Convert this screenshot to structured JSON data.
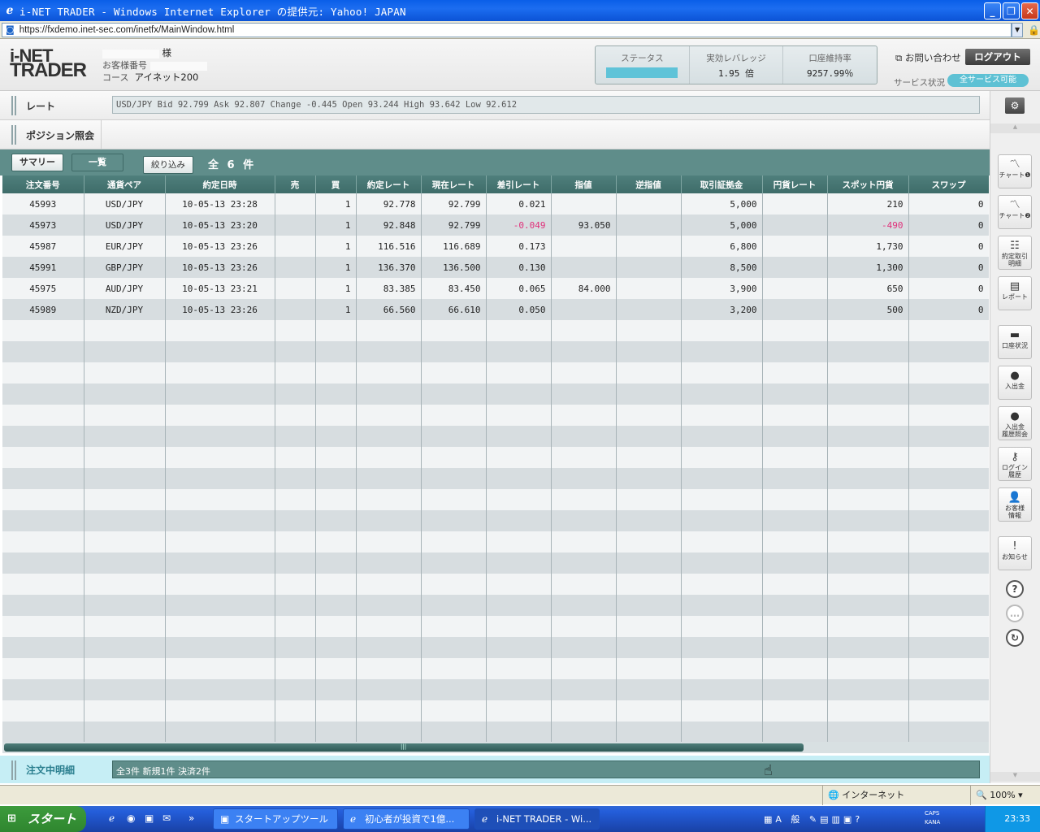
{
  "window": {
    "title": "i-NET TRADER - Windows Internet Explorer の提供元: Yahoo! JAPAN",
    "url": "https://fxdemo.inet-sec.com/inetfx/MainWindow.html"
  },
  "header": {
    "logo_line1": "i-NET",
    "logo_line2": "TRADER",
    "customer_suffix": "様",
    "customer_number_label": "お客様番号",
    "course_label": "コース",
    "course_value": "アイネット200",
    "status_label": "ステータス",
    "leverage_label": "実効レバレッジ",
    "leverage_value": "1.95 倍",
    "margin_label": "口座維持率",
    "margin_value": "9257.99％",
    "contact_label": "お問い合わせ",
    "logout_label": "ログアウト",
    "service_label": "サービス状況",
    "service_value": "全サービス可能"
  },
  "rate": {
    "label": "レート",
    "ticker": "USD/JPY Bid 92.799 Ask 92.807 Change -0.445 Open 93.244 High 93.642 Low 92.612"
  },
  "position": {
    "label": "ポジション照会",
    "tab_summary": "サマリー",
    "tab_list": "一覧",
    "filter_label": "絞り込み",
    "count_label": "全 6 件"
  },
  "table": {
    "columns": [
      "注文番号",
      "通貨ペア",
      "約定日時",
      "売",
      "買",
      "約定レート",
      "現在レート",
      "差引レート",
      "指値",
      "逆指値",
      "取引証拠金",
      "円貨レート",
      "スポット円貨",
      "スワップ"
    ],
    "rows": [
      [
        "45993",
        "USD/JPY",
        "10-05-13 23:28",
        "",
        "1",
        "92.778",
        "92.799",
        "0.021",
        "",
        "",
        "5,000",
        "",
        "210",
        "0"
      ],
      [
        "45973",
        "USD/JPY",
        "10-05-13 23:20",
        "",
        "1",
        "92.848",
        "92.799",
        "-0.049",
        "93.050",
        "",
        "5,000",
        "",
        "-490",
        "0"
      ],
      [
        "45987",
        "EUR/JPY",
        "10-05-13 23:26",
        "",
        "1",
        "116.516",
        "116.689",
        "0.173",
        "",
        "",
        "6,800",
        "",
        "1,730",
        "0"
      ],
      [
        "45991",
        "GBP/JPY",
        "10-05-13 23:26",
        "",
        "1",
        "136.370",
        "136.500",
        "0.130",
        "",
        "",
        "8,500",
        "",
        "1,300",
        "0"
      ],
      [
        "45975",
        "AUD/JPY",
        "10-05-13 23:21",
        "",
        "1",
        "83.385",
        "83.450",
        "0.065",
        "84.000",
        "",
        "3,900",
        "",
        "650",
        "0"
      ],
      [
        "45989",
        "NZD/JPY",
        "10-05-13 23:26",
        "",
        "1",
        "66.560",
        "66.610",
        "0.050",
        "",
        "",
        "3,200",
        "",
        "500",
        "0"
      ]
    ]
  },
  "orders": {
    "label": "注文中明細",
    "summary": "全3件 新規1件 決済2件"
  },
  "side": {
    "chart1": "チャート❶",
    "chart2": "チャート❷",
    "trades_l1": "約定取引",
    "trades_l2": "明細",
    "report": "レポート",
    "account": "口座状況",
    "deposit": "入出金",
    "history_l1": "入出金",
    "history_l2": "履歴照会",
    "login_l1": "ログイン",
    "login_l2": "履歴",
    "customer_l1": "お客様",
    "customer_l2": "情報",
    "notice": "お知らせ"
  },
  "statusbar": {
    "zone": "インターネット",
    "zoom": "100%"
  },
  "taskbar": {
    "start": "スタート",
    "task1": "スタートアップツール",
    "task2": "初心者が投資で1億...",
    "task3": "i-NET TRADER - Wi...",
    "ime": "A 般",
    "caps1": "CAPS",
    "caps2": "KANA",
    "clock": "23:33"
  }
}
